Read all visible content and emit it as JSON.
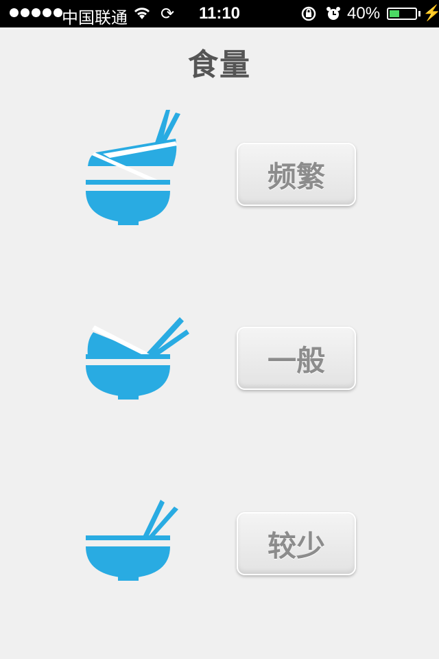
{
  "status_bar": {
    "carrier": "中国联通",
    "time": "11:10",
    "battery_percent": "40%",
    "battery_level": 0.4,
    "icons": [
      "signal-dots-icon",
      "wifi-icon",
      "sync-icon",
      "orientation-lock-icon",
      "alarm-icon",
      "battery-icon",
      "charging-icon"
    ]
  },
  "page": {
    "title": "食量"
  },
  "options": [
    {
      "label": "频繁",
      "icon": "full-bowl-chopsticks-icon"
    },
    {
      "label": "一般",
      "icon": "half-bowl-chopsticks-icon"
    },
    {
      "label": "较少",
      "icon": "empty-bowl-chopsticks-icon"
    }
  ],
  "colors": {
    "accent": "#29abe2",
    "background": "#f0f0f0",
    "button_text": "#8c8c8c",
    "title": "#555555"
  }
}
